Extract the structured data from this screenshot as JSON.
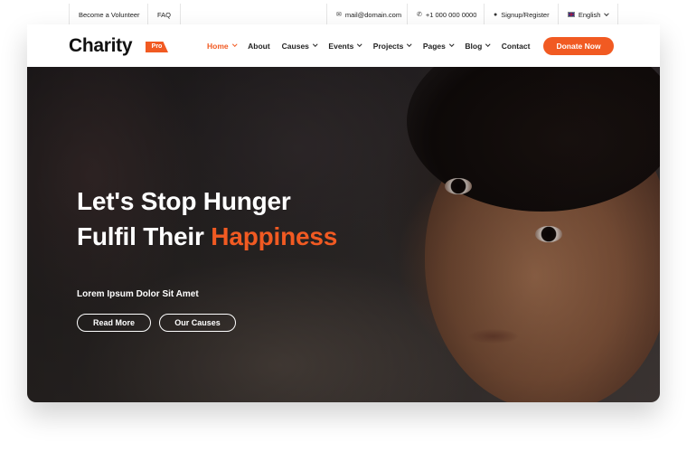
{
  "topbar": {
    "volunteer": "Become a Volunteer",
    "faq": "FAQ",
    "email": "mail@domain.com",
    "phone": "+1 000 000 0000",
    "signup": "Signup/Register",
    "language": "English"
  },
  "header": {
    "logo": "Charity",
    "logo_badge": "Pro",
    "nav": [
      {
        "label": "Home",
        "active": true,
        "dropdown": true
      },
      {
        "label": "About",
        "active": false,
        "dropdown": false
      },
      {
        "label": "Causes",
        "active": false,
        "dropdown": true
      },
      {
        "label": "Events",
        "active": false,
        "dropdown": true
      },
      {
        "label": "Projects",
        "active": false,
        "dropdown": true
      },
      {
        "label": "Pages",
        "active": false,
        "dropdown": true
      },
      {
        "label": "Blog",
        "active": false,
        "dropdown": true
      },
      {
        "label": "Contact",
        "active": false,
        "dropdown": false
      }
    ],
    "donate": "Donate Now"
  },
  "hero": {
    "line1": "Let's Stop Hunger",
    "line2_prefix": "Fulfil Their ",
    "line2_accent": "Happiness",
    "subtitle": "Lorem Ipsum Dolor Sit Amet",
    "read_more": "Read More",
    "our_causes": "Our Causes",
    "slides": 3,
    "active_slide": 1
  },
  "colors": {
    "accent": "#f15a22",
    "text": "#222222",
    "white": "#ffffff"
  },
  "icons": [
    "mail-icon",
    "phone-icon",
    "user-icon",
    "uk-flag-icon",
    "chevron-down-icon"
  ]
}
